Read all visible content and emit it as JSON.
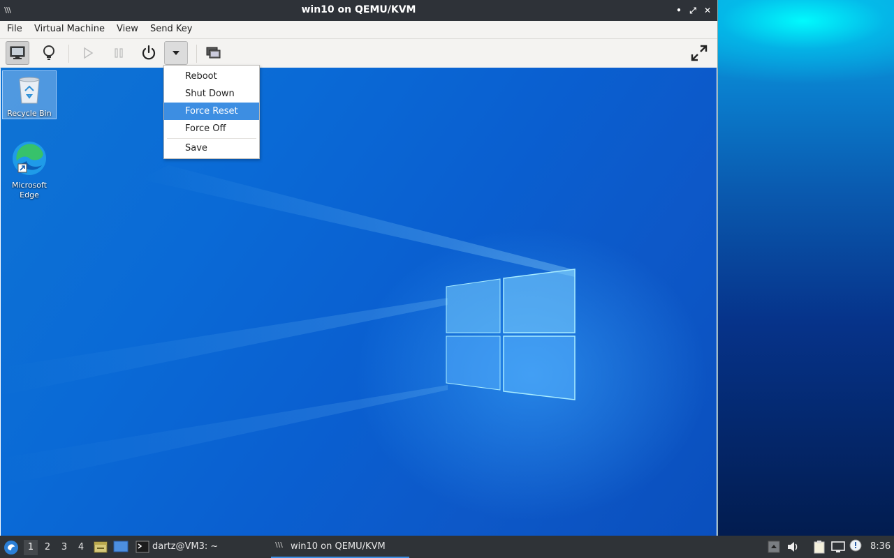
{
  "window": {
    "title": "win10 on QEMU/KVM",
    "logo_text": "\\\\\\",
    "minimize_glyph": "•",
    "maximize_glyph": "⤢",
    "close_glyph": "✕"
  },
  "menubar": {
    "items": [
      "File",
      "Virtual Machine",
      "View",
      "Send Key"
    ]
  },
  "toolbar": {
    "console_icon": "monitor-icon",
    "details_icon": "lightbulb-icon",
    "run_icon": "play-icon",
    "pause_icon": "pause-icon",
    "power_icon": "power-icon",
    "dropdown_icon": "caret-down-icon",
    "snapshot_icon": "snapshot-icon",
    "fullscreen_icon": "fullscreen-icon"
  },
  "power_menu": {
    "items": [
      "Reboot",
      "Shut Down",
      "Force Reset",
      "Force Off",
      "Save"
    ],
    "highlighted": "Force Reset"
  },
  "guest_desktop": {
    "icons": [
      {
        "label": "Recycle Bin",
        "icon": "recycle-bin-icon"
      },
      {
        "label": "Microsoft Edge",
        "icon": "edge-icon"
      }
    ]
  },
  "taskbar": {
    "workspaces": [
      "1",
      "2",
      "3",
      "4"
    ],
    "current_workspace": "1",
    "terminal_task": "dartz@VM3: ~",
    "vm_task": "win10 on QEMU/KVM",
    "clock": "8:36"
  },
  "colors": {
    "highlight": "#3d8ee2",
    "titlebar": "#2e3238",
    "taskbar": "#2f3337"
  }
}
